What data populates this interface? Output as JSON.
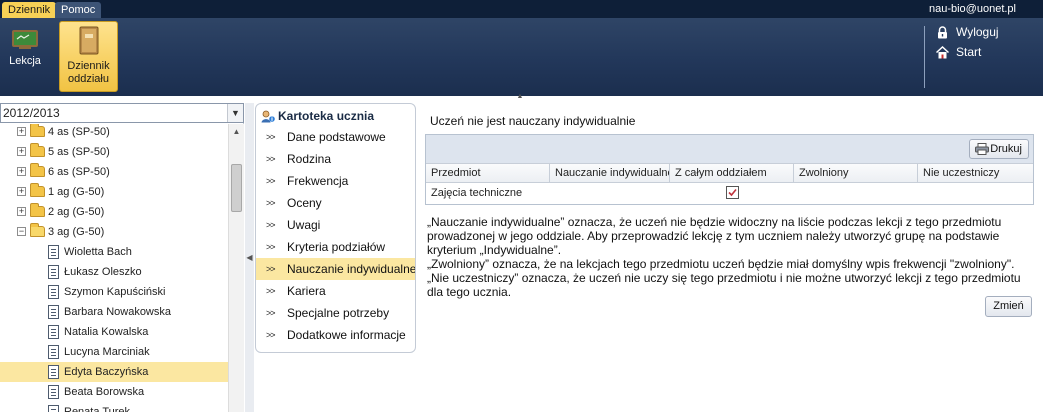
{
  "menu_tabs": {
    "active": "Dziennik",
    "inactive": "Pomoc"
  },
  "user_email": "nau-bio@uonet.pl",
  "ribbon": {
    "lekcja": "Lekcja",
    "dziennik_line1": "Dziennik",
    "dziennik_line2": "oddziału",
    "logout": "Wyloguj",
    "start": "Start"
  },
  "year_select": "2012/2013",
  "tree": {
    "items": [
      {
        "label": "4 as (SP-50)",
        "kind": "folder"
      },
      {
        "label": "5 as (SP-50)",
        "kind": "folder"
      },
      {
        "label": "6 as (SP-50)",
        "kind": "folder"
      },
      {
        "label": "1 ag (G-50)",
        "kind": "folder"
      },
      {
        "label": "2 ag (G-50)",
        "kind": "folder"
      },
      {
        "label": "3 ag (G-50)",
        "kind": "folder-open"
      },
      {
        "label": "Wioletta Bach",
        "kind": "student"
      },
      {
        "label": "Łukasz Oleszko",
        "kind": "student"
      },
      {
        "label": "Szymon Kapuściński",
        "kind": "student"
      },
      {
        "label": "Barbara Nowakowska",
        "kind": "student"
      },
      {
        "label": "Natalia Kowalska",
        "kind": "student"
      },
      {
        "label": "Lucyna Marciniak",
        "kind": "student"
      },
      {
        "label": "Edyta Baczyńska",
        "kind": "student",
        "selected": true
      },
      {
        "label": "Beata Borowska",
        "kind": "student"
      },
      {
        "label": "Renata Turek",
        "kind": "student"
      }
    ]
  },
  "card": {
    "title": "Kartoteka ucznia",
    "items": [
      "Dane podstawowe",
      "Rodzina",
      "Frekwencja",
      "Oceny",
      "Uwagi",
      "Kryteria podziałów",
      "Nauczanie indywidualne",
      "Kariera",
      "Specjalne potrzeby",
      "Dodatkowe informacje"
    ],
    "active_index": 6
  },
  "main": {
    "title": "Uczeń nie jest nauczany indywidualnie",
    "print_label": "Drukuj",
    "columns": [
      "Przedmiot",
      "Nauczanie indywidualne",
      "Z całym oddziałem",
      "Zwolniony",
      "Nie uczestniczy"
    ],
    "rows": [
      {
        "subject": "Zajęcia techniczne",
        "with_whole_class": true
      }
    ],
    "note_line1": "„Nauczanie indywidualne” oznacza, że uczeń nie będzie widoczny na liście podczas lekcji z tego przedmiotu",
    "note_line2": "prowadzonej w jego oddziale. Aby przeprowadzić lekcję z tym uczniem należy utworzyć grupę na podstawie",
    "note_line3": "kryterium „Indywidualne”.",
    "note_line4": "„Zwolniony” oznacza, że na lekcjach tego przedmiotu uczeń będzie miał domyślny wpis frekwencji \"zwolniony\".",
    "note_line5": "„Nie uczestniczy” oznacza, że uczeń nie uczy się tego przedmiotu i nie możne utworzyć lekcji z tego przedmiotu",
    "note_line6": "dla tego ucznia.",
    "change_label": "Zmień"
  },
  "colors": {
    "top_bar": "#0e1f38",
    "ribbon": "#22375a",
    "active_tab": "#f7d156",
    "selected_row": "#fbe7a1"
  }
}
